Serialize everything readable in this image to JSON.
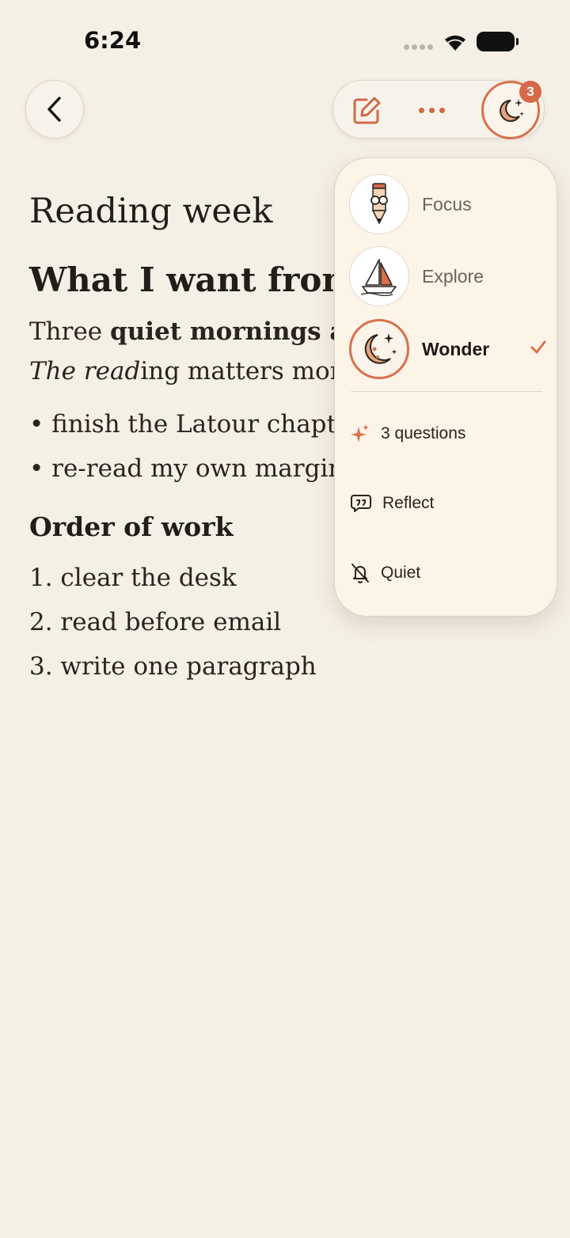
{
  "status": {
    "time": "6:24"
  },
  "toolbar": {
    "badge_count": "3"
  },
  "document": {
    "title": "Reading week",
    "heading1": "What I want from",
    "para_line1": {
      "t1": "Three ",
      "bold": "quiet mornings and"
    },
    "para_line2": {
      "i1": "The ",
      "i2": "read",
      "t3": "ing matters more t"
    },
    "bullets": [
      "• finish the Latour chapter",
      "• re-read my own margin n"
    ],
    "heading2": "Order of work",
    "steps": [
      "1. clear the desk",
      "2. read before email",
      "3. write one paragraph"
    ]
  },
  "menu": {
    "modes": [
      {
        "label": "Focus",
        "icon": "pencil-character-icon",
        "selected": false
      },
      {
        "label": "Explore",
        "icon": "sailboat-icon",
        "selected": false
      },
      {
        "label": "Wonder",
        "icon": "moon-stars-icon",
        "selected": true
      }
    ],
    "actions": [
      {
        "label": "3 questions",
        "icon": "sparkle-icon"
      },
      {
        "label": "Reflect",
        "icon": "quote-bubble-icon"
      },
      {
        "label": "Quiet",
        "icon": "bell-off-icon"
      }
    ]
  },
  "colors": {
    "accent": "#d9704d",
    "background": "#f5f0e6",
    "menu_bg": "#fdf4e8"
  }
}
